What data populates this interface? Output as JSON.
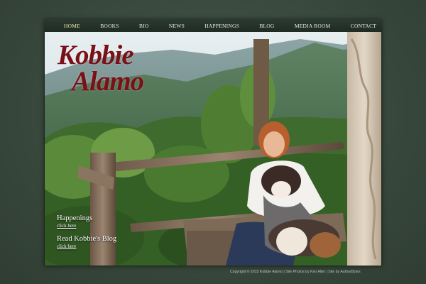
{
  "nav": {
    "items": [
      "HOME",
      "BOOKS",
      "BIO",
      "NEWS",
      "HAPPENINGS",
      "BLOG",
      "MEDIA ROOM",
      "CONTACT"
    ],
    "active": "HOME"
  },
  "brand": {
    "line1": "Kobbie",
    "line2": "Alamo",
    "color": "#7a1018"
  },
  "promos": {
    "happenings": {
      "title": "Happenings",
      "link": "click here"
    },
    "blog": {
      "title": "Read Kobbie's Blog",
      "link": "click here"
    }
  },
  "footer": {
    "text": "Copyright © 2015 Kobbie Alamo | Site Photos by Ken Alter | Site by AuthorBytes"
  },
  "colors": {
    "background": "#3a4a3d",
    "nav_background": "#1f2b24",
    "nav_active": "#e9e6a8"
  }
}
